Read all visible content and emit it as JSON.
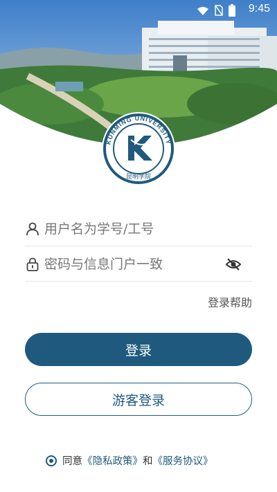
{
  "status": {
    "time": "9:45"
  },
  "logo": {
    "university_name": "KUNMING UNIVERSITY",
    "chinese_name": "昆明学院"
  },
  "login": {
    "username_placeholder": "用户名为学号/工号",
    "password_placeholder": "密码与信息门户一致",
    "help_label": "登录帮助",
    "login_button": "登录",
    "guest_button": "游客登录"
  },
  "agreement": {
    "prefix": "同意",
    "privacy_link": "《隐私政策》",
    "and": "和",
    "service_link": "《服务协议》"
  },
  "colors": {
    "brand": "#1f5a7e"
  },
  "icons": [
    "wifi-icon",
    "no-sim-icon",
    "battery-icon",
    "user-icon",
    "lock-icon",
    "eye-off-icon",
    "radio-icon"
  ]
}
